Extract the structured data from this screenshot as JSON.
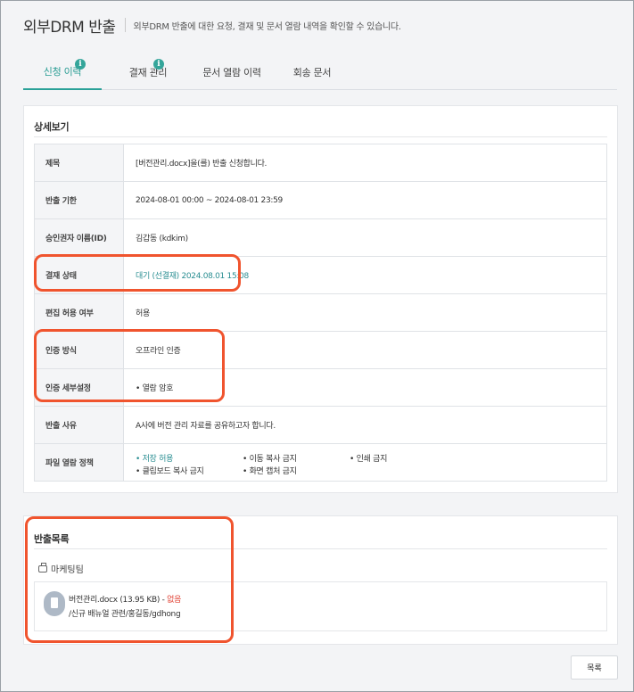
{
  "header": {
    "title": "외부DRM 반출",
    "description": "외부DRM 반출에 대한 요청, 결재 및 문서 열람 내역을 확인할 수 있습니다."
  },
  "tabs": [
    {
      "label": "신청 이력",
      "badge": "i"
    },
    {
      "label": "결재 관리",
      "badge": "i"
    },
    {
      "label": "문서 열람 이력"
    },
    {
      "label": "회송 문서"
    }
  ],
  "detail": {
    "title": "상세보기",
    "rows": [
      {
        "key": "제목",
        "value": "[버전관리.docx]을(를) 반출 신청합니다."
      },
      {
        "key": "반출 기한",
        "value": "2024-08-01 00:00 ~ 2024-08-01 23:59"
      },
      {
        "key": "승인권자 이름(ID)",
        "value": "김갑동 (kdkim)"
      },
      {
        "key": "결재 상태",
        "value": "대기 (선결재) 2024.08.01 15:08"
      },
      {
        "key": "편집 허용 여부",
        "value": "허용"
      },
      {
        "key": "인증 방식",
        "value": "오프라인 인증"
      },
      {
        "key": "인증 세부설정",
        "value": "• 열람 암호"
      },
      {
        "key": "반출 사유",
        "value": "A사에 버전 관리 자료를 공유하고자 합니다."
      },
      {
        "key": "파일 열람 정책",
        "value": ""
      }
    ],
    "policy": {
      "save": "• 저장 허용",
      "move_copy": "• 이동 복사 금지",
      "print": "• 인쇄 금지",
      "clipboard": "• 클립보드 복사 금지",
      "capture": "• 화면 캡처 금지"
    }
  },
  "export_list": {
    "title": "반출목록",
    "department": "마케팅팀",
    "file": {
      "name": "버전관리.docx (13.95 KB) - ",
      "status": "없음",
      "path": "/신규 배뉴얼 관련/홍길동/gdhong"
    }
  },
  "buttons": {
    "list": "목록"
  },
  "colors": {
    "accent": "#2aa198",
    "highlight": "#f0542e",
    "status_red": "#e03c2e"
  }
}
